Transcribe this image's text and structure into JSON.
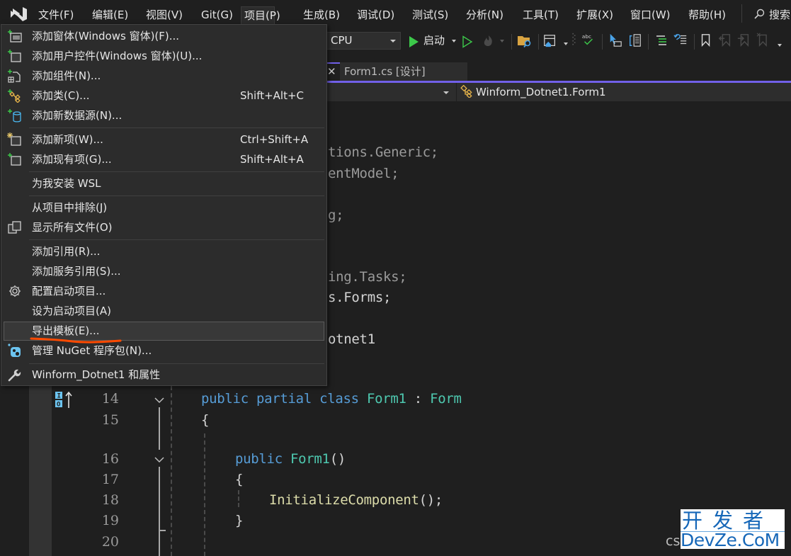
{
  "menubar": {
    "items": [
      {
        "label": "文件(F)"
      },
      {
        "label": "编辑(E)"
      },
      {
        "label": "视图(V)"
      },
      {
        "label": "Git(G)"
      },
      {
        "label": "项目(P)",
        "active": true
      },
      {
        "label": "生成(B)"
      },
      {
        "label": "调试(D)"
      },
      {
        "label": "测试(S)"
      },
      {
        "label": "分析(N)"
      },
      {
        "label": "工具(T)"
      },
      {
        "label": "扩展(X)"
      },
      {
        "label": "窗口(W)"
      },
      {
        "label": "帮助(H)"
      }
    ],
    "search_label": "搜索"
  },
  "toolbar": {
    "platform_value": "CPU",
    "start_label": "启动"
  },
  "tabs": {
    "active_tab": "Form1.cs [设计]",
    "close_glyph": "✕"
  },
  "navbar": {
    "class_selector": "Winform_Dotnet1.Form1"
  },
  "project_menu": {
    "items": [
      {
        "label": "添加窗体(Windows 窗体)(F)...",
        "icon": "add-form-icon",
        "shortcut": ""
      },
      {
        "label": "添加用户控件(Windows 窗体)(U)...",
        "icon": "add-user-control-icon",
        "shortcut": ""
      },
      {
        "label": "添加组件(N)...",
        "icon": "add-component-icon",
        "shortcut": ""
      },
      {
        "label": "添加类(C)...",
        "icon": "add-class-icon",
        "shortcut": "Shift+Alt+C"
      },
      {
        "label": "添加新数据源(N)...",
        "icon": "add-datasource-icon",
        "shortcut": ""
      },
      {
        "label": "添加新项(W)...",
        "icon": "add-new-item-icon",
        "shortcut": "Ctrl+Shift+A"
      },
      {
        "label": "添加现有项(G)...",
        "icon": "add-existing-item-icon",
        "shortcut": "Shift+Alt+A"
      },
      {
        "label": "为我安装 WSL",
        "icon": "",
        "shortcut": ""
      },
      {
        "label": "从项目中排除(J)",
        "icon": "",
        "shortcut": ""
      },
      {
        "label": "显示所有文件(O)",
        "icon": "show-all-files-icon",
        "shortcut": ""
      },
      {
        "label": "添加引用(R)...",
        "icon": "",
        "shortcut": ""
      },
      {
        "label": "添加服务引用(S)...",
        "icon": "",
        "shortcut": ""
      },
      {
        "label": "配置启动项目...",
        "icon": "gear-icon",
        "shortcut": ""
      },
      {
        "label": "设为启动项目(A)",
        "icon": "",
        "shortcut": ""
      },
      {
        "label": "导出模板(E)...",
        "icon": "",
        "shortcut": "",
        "highlighted": true
      },
      {
        "label": "管理 NuGet 程序包(N)...",
        "icon": "nuget-icon",
        "shortcut": ""
      },
      {
        "label": "Winform_Dotnet1 和属性",
        "icon": "wrench-icon",
        "shortcut": ""
      }
    ]
  },
  "editor": {
    "partial_lines": [
      "tions.Generic;",
      "entModel;",
      "g;",
      "ing.Tasks;",
      "s.Forms;",
      "otnet1"
    ],
    "line_numbers": [
      "14",
      "15",
      "16",
      "17",
      "18",
      "19",
      "20"
    ],
    "code": {
      "l14_kw1": "public",
      "l14_kw2": "partial",
      "l14_kw3": "class",
      "l14_type1": "Form1",
      "l14_colon": " : ",
      "l14_type2": "Form",
      "l15": "{",
      "l16_kw": "public",
      "l16_type": "Form1",
      "l16_parens": "()",
      "l17": "{",
      "l18_fn": "InitializeComponent",
      "l18_rest": "();",
      "l19": "}"
    }
  },
  "watermark": {
    "prefix": "cs",
    "top": "开发者",
    "bottom": "DevZe.CoM"
  },
  "colors": {
    "accent": "#7160e8",
    "keyword": "#569cd6",
    "type": "#4ec9b0",
    "method": "#dcdcaa",
    "annotation_underline": "#ff4a00"
  }
}
